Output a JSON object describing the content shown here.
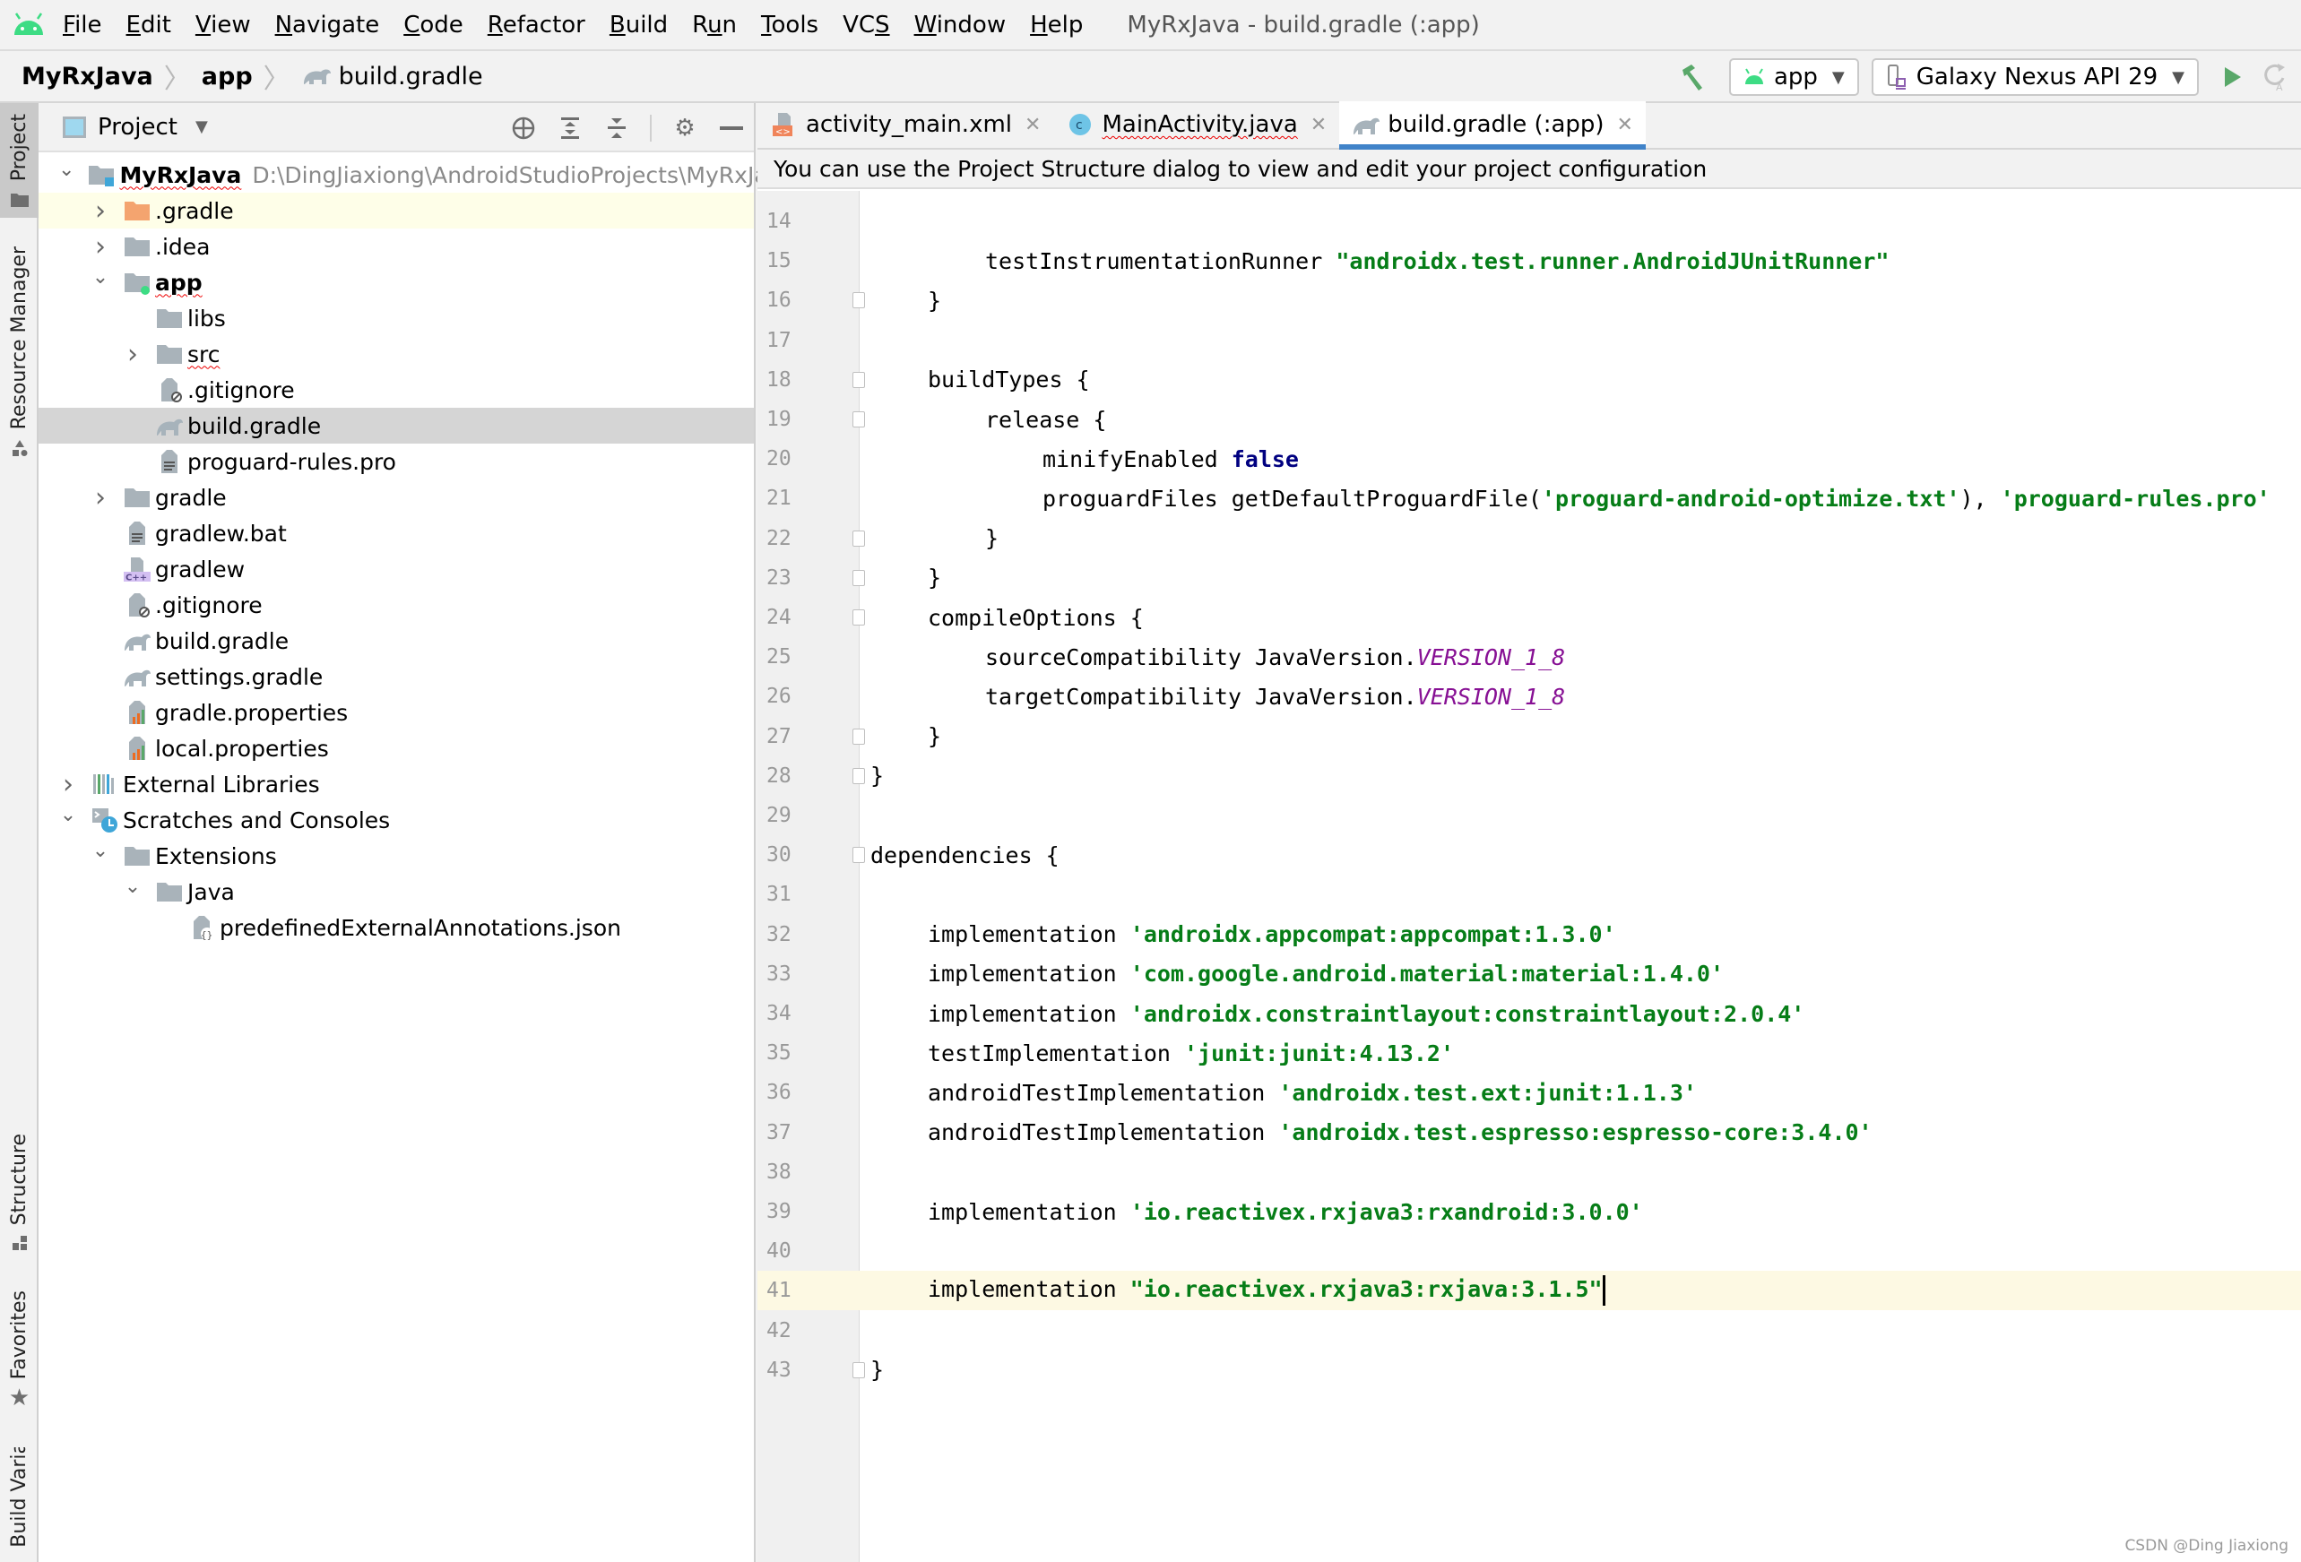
{
  "menubar": {
    "items": [
      "File",
      "Edit",
      "View",
      "Navigate",
      "Code",
      "Refactor",
      "Build",
      "Run",
      "Tools",
      "VCS",
      "Window",
      "Help"
    ],
    "mnemonics": [
      "F",
      "E",
      "V",
      "N",
      "C",
      "R",
      "B",
      "u",
      "T",
      "S",
      "W",
      "H"
    ],
    "window_title": "MyRxJava - build.gradle (:app)"
  },
  "navbar": {
    "breadcrumb": [
      "MyRxJava",
      "app",
      "build.gradle"
    ],
    "run_config": "app",
    "device": "Galaxy Nexus API 29"
  },
  "left_strip": {
    "tabs": [
      "Project",
      "Resource Manager",
      "Structure",
      "Favorites",
      "Build Variants"
    ]
  },
  "project_panel": {
    "title": "Project",
    "tree": [
      {
        "label": "MyRxJava",
        "path": "D:\\DingJiaxiong\\AndroidStudioProjects\\MyRxJava",
        "depth": 0,
        "expanded": true,
        "icon": "module-folder",
        "bold": true
      },
      {
        "label": ".gradle",
        "depth": 1,
        "expanded": false,
        "icon": "folder-orange"
      },
      {
        "label": ".idea",
        "depth": 1,
        "expanded": false,
        "icon": "folder"
      },
      {
        "label": "app",
        "depth": 1,
        "expanded": true,
        "icon": "android-module-folder",
        "bold": true
      },
      {
        "label": "libs",
        "depth": 2,
        "icon": "folder"
      },
      {
        "label": "src",
        "depth": 2,
        "expanded": false,
        "icon": "folder"
      },
      {
        "label": ".gitignore",
        "depth": 2,
        "icon": "gitignore-file"
      },
      {
        "label": "build.gradle",
        "depth": 2,
        "icon": "gradle-file",
        "selected": true
      },
      {
        "label": "proguard-rules.pro",
        "depth": 2,
        "icon": "text-file"
      },
      {
        "label": "gradle",
        "depth": 1,
        "expanded": false,
        "icon": "folder"
      },
      {
        "label": "gradlew.bat",
        "depth": 1,
        "icon": "text-file"
      },
      {
        "label": "gradlew",
        "depth": 1,
        "icon": "cpp-file"
      },
      {
        "label": ".gitignore",
        "depth": 1,
        "icon": "gitignore-file"
      },
      {
        "label": "build.gradle",
        "depth": 1,
        "icon": "gradle-file"
      },
      {
        "label": "settings.gradle",
        "depth": 1,
        "icon": "gradle-file"
      },
      {
        "label": "gradle.properties",
        "depth": 1,
        "icon": "properties-file"
      },
      {
        "label": "local.properties",
        "depth": 1,
        "icon": "properties-file"
      },
      {
        "label": "External Libraries",
        "depth": 0,
        "expanded": false,
        "icon": "libraries"
      },
      {
        "label": "Scratches and Consoles",
        "depth": 0,
        "expanded": true,
        "icon": "scratches"
      },
      {
        "label": "Extensions",
        "depth": 1,
        "expanded": true,
        "icon": "folder"
      },
      {
        "label": "Java",
        "depth": 2,
        "expanded": true,
        "icon": "folder"
      },
      {
        "label": "predefinedExternalAnnotations.json",
        "depth": 3,
        "icon": "json-file"
      }
    ]
  },
  "editor": {
    "tabs": [
      {
        "label": "activity_main.xml",
        "icon": "xml-file",
        "active": false
      },
      {
        "label": "MainActivity.java",
        "icon": "java-class",
        "active": false
      },
      {
        "label": "build.gradle (:app)",
        "icon": "gradle-file",
        "active": true
      }
    ],
    "banner": "You can use the Project Structure dialog to view and edit your project configuration",
    "current_line": 41,
    "lines": [
      {
        "n": "14",
        "indent": 2,
        "parts": []
      },
      {
        "n": "15",
        "indent": 2,
        "parts": [
          {
            "t": "testInstrumentationRunner ",
            "c": ""
          },
          {
            "t": "\"androidx.test.runner.AndroidJUnitRunner\"",
            "c": "str"
          }
        ]
      },
      {
        "n": "16",
        "indent": 1,
        "parts": [
          {
            "t": "}",
            "c": ""
          }
        ]
      },
      {
        "n": "17",
        "indent": 1,
        "parts": []
      },
      {
        "n": "18",
        "indent": 1,
        "parts": [
          {
            "t": "buildTypes {",
            "c": ""
          }
        ]
      },
      {
        "n": "19",
        "indent": 2,
        "parts": [
          {
            "t": "release {",
            "c": ""
          }
        ]
      },
      {
        "n": "20",
        "indent": 3,
        "parts": [
          {
            "t": "minifyEnabled ",
            "c": ""
          },
          {
            "t": "false",
            "c": "kw"
          }
        ]
      },
      {
        "n": "21",
        "indent": 3,
        "parts": [
          {
            "t": "proguardFiles getDefaultProguardFile(",
            "c": ""
          },
          {
            "t": "'proguard-android-optimize.txt'",
            "c": "str"
          },
          {
            "t": "), ",
            "c": ""
          },
          {
            "t": "'proguard-rules.pro'",
            "c": "str"
          }
        ]
      },
      {
        "n": "22",
        "indent": 2,
        "parts": [
          {
            "t": "}",
            "c": ""
          }
        ]
      },
      {
        "n": "23",
        "indent": 1,
        "parts": [
          {
            "t": "}",
            "c": ""
          }
        ]
      },
      {
        "n": "24",
        "indent": 1,
        "parts": [
          {
            "t": "compileOptions {",
            "c": ""
          }
        ]
      },
      {
        "n": "25",
        "indent": 2,
        "parts": [
          {
            "t": "sourceCompatibility JavaVersion.",
            "c": ""
          },
          {
            "t": "VERSION_1_8",
            "c": "const"
          }
        ]
      },
      {
        "n": "26",
        "indent": 2,
        "parts": [
          {
            "t": "targetCompatibility JavaVersion.",
            "c": ""
          },
          {
            "t": "VERSION_1_8",
            "c": "const"
          }
        ]
      },
      {
        "n": "27",
        "indent": 1,
        "parts": [
          {
            "t": "}",
            "c": ""
          }
        ]
      },
      {
        "n": "28",
        "indent": 0,
        "parts": [
          {
            "t": "}",
            "c": ""
          }
        ]
      },
      {
        "n": "29",
        "indent": 0,
        "parts": []
      },
      {
        "n": "30",
        "indent": 0,
        "parts": [
          {
            "t": "dependencies {",
            "c": ""
          }
        ]
      },
      {
        "n": "31",
        "indent": 0,
        "parts": []
      },
      {
        "n": "32",
        "indent": 1,
        "parts": [
          {
            "t": "implementation ",
            "c": ""
          },
          {
            "t": "'androidx.appcompat:appcompat:1.3.0'",
            "c": "str"
          }
        ]
      },
      {
        "n": "33",
        "indent": 1,
        "parts": [
          {
            "t": "implementation ",
            "c": ""
          },
          {
            "t": "'com.google.android.material:material:1.4.0'",
            "c": "str"
          }
        ]
      },
      {
        "n": "34",
        "indent": 1,
        "parts": [
          {
            "t": "implementation ",
            "c": ""
          },
          {
            "t": "'androidx.constraintlayout:constraintlayout:2.0.4'",
            "c": "str"
          }
        ]
      },
      {
        "n": "35",
        "indent": 1,
        "parts": [
          {
            "t": "testImplementation ",
            "c": ""
          },
          {
            "t": "'junit:junit:4.13.2'",
            "c": "str"
          }
        ]
      },
      {
        "n": "36",
        "indent": 1,
        "parts": [
          {
            "t": "androidTestImplementation ",
            "c": ""
          },
          {
            "t": "'androidx.test.ext:junit:1.1.3'",
            "c": "str"
          }
        ]
      },
      {
        "n": "37",
        "indent": 1,
        "parts": [
          {
            "t": "androidTestImplementation ",
            "c": ""
          },
          {
            "t": "'androidx.test.espresso:espresso-core:3.4.0'",
            "c": "str"
          }
        ]
      },
      {
        "n": "38",
        "indent": 1,
        "parts": []
      },
      {
        "n": "39",
        "indent": 1,
        "parts": [
          {
            "t": "implementation ",
            "c": ""
          },
          {
            "t": "'io.reactivex.rxjava3:rxandroid:3.0.0'",
            "c": "str"
          }
        ]
      },
      {
        "n": "40",
        "indent": 1,
        "parts": []
      },
      {
        "n": "41",
        "indent": 1,
        "parts": [
          {
            "t": "implementation ",
            "c": ""
          },
          {
            "t": "\"io.reactivex.rxjava3:rxjava:3.1.5\"",
            "c": "str"
          }
        ]
      },
      {
        "n": "42",
        "indent": 1,
        "parts": []
      },
      {
        "n": "43",
        "indent": 0,
        "parts": [
          {
            "t": "}",
            "c": ""
          }
        ]
      }
    ],
    "fold_markers": [
      "16",
      "18",
      "19",
      "22",
      "23",
      "24",
      "27",
      "28",
      "30",
      "43"
    ]
  },
  "watermark": "CSDN @Ding Jiaxiong",
  "colors": {
    "accent": "#4083c9",
    "string": "#067d17",
    "keyword": "#000080",
    "constant": "#871094",
    "android_green": "#3ddc84",
    "run_green": "#59a869"
  }
}
